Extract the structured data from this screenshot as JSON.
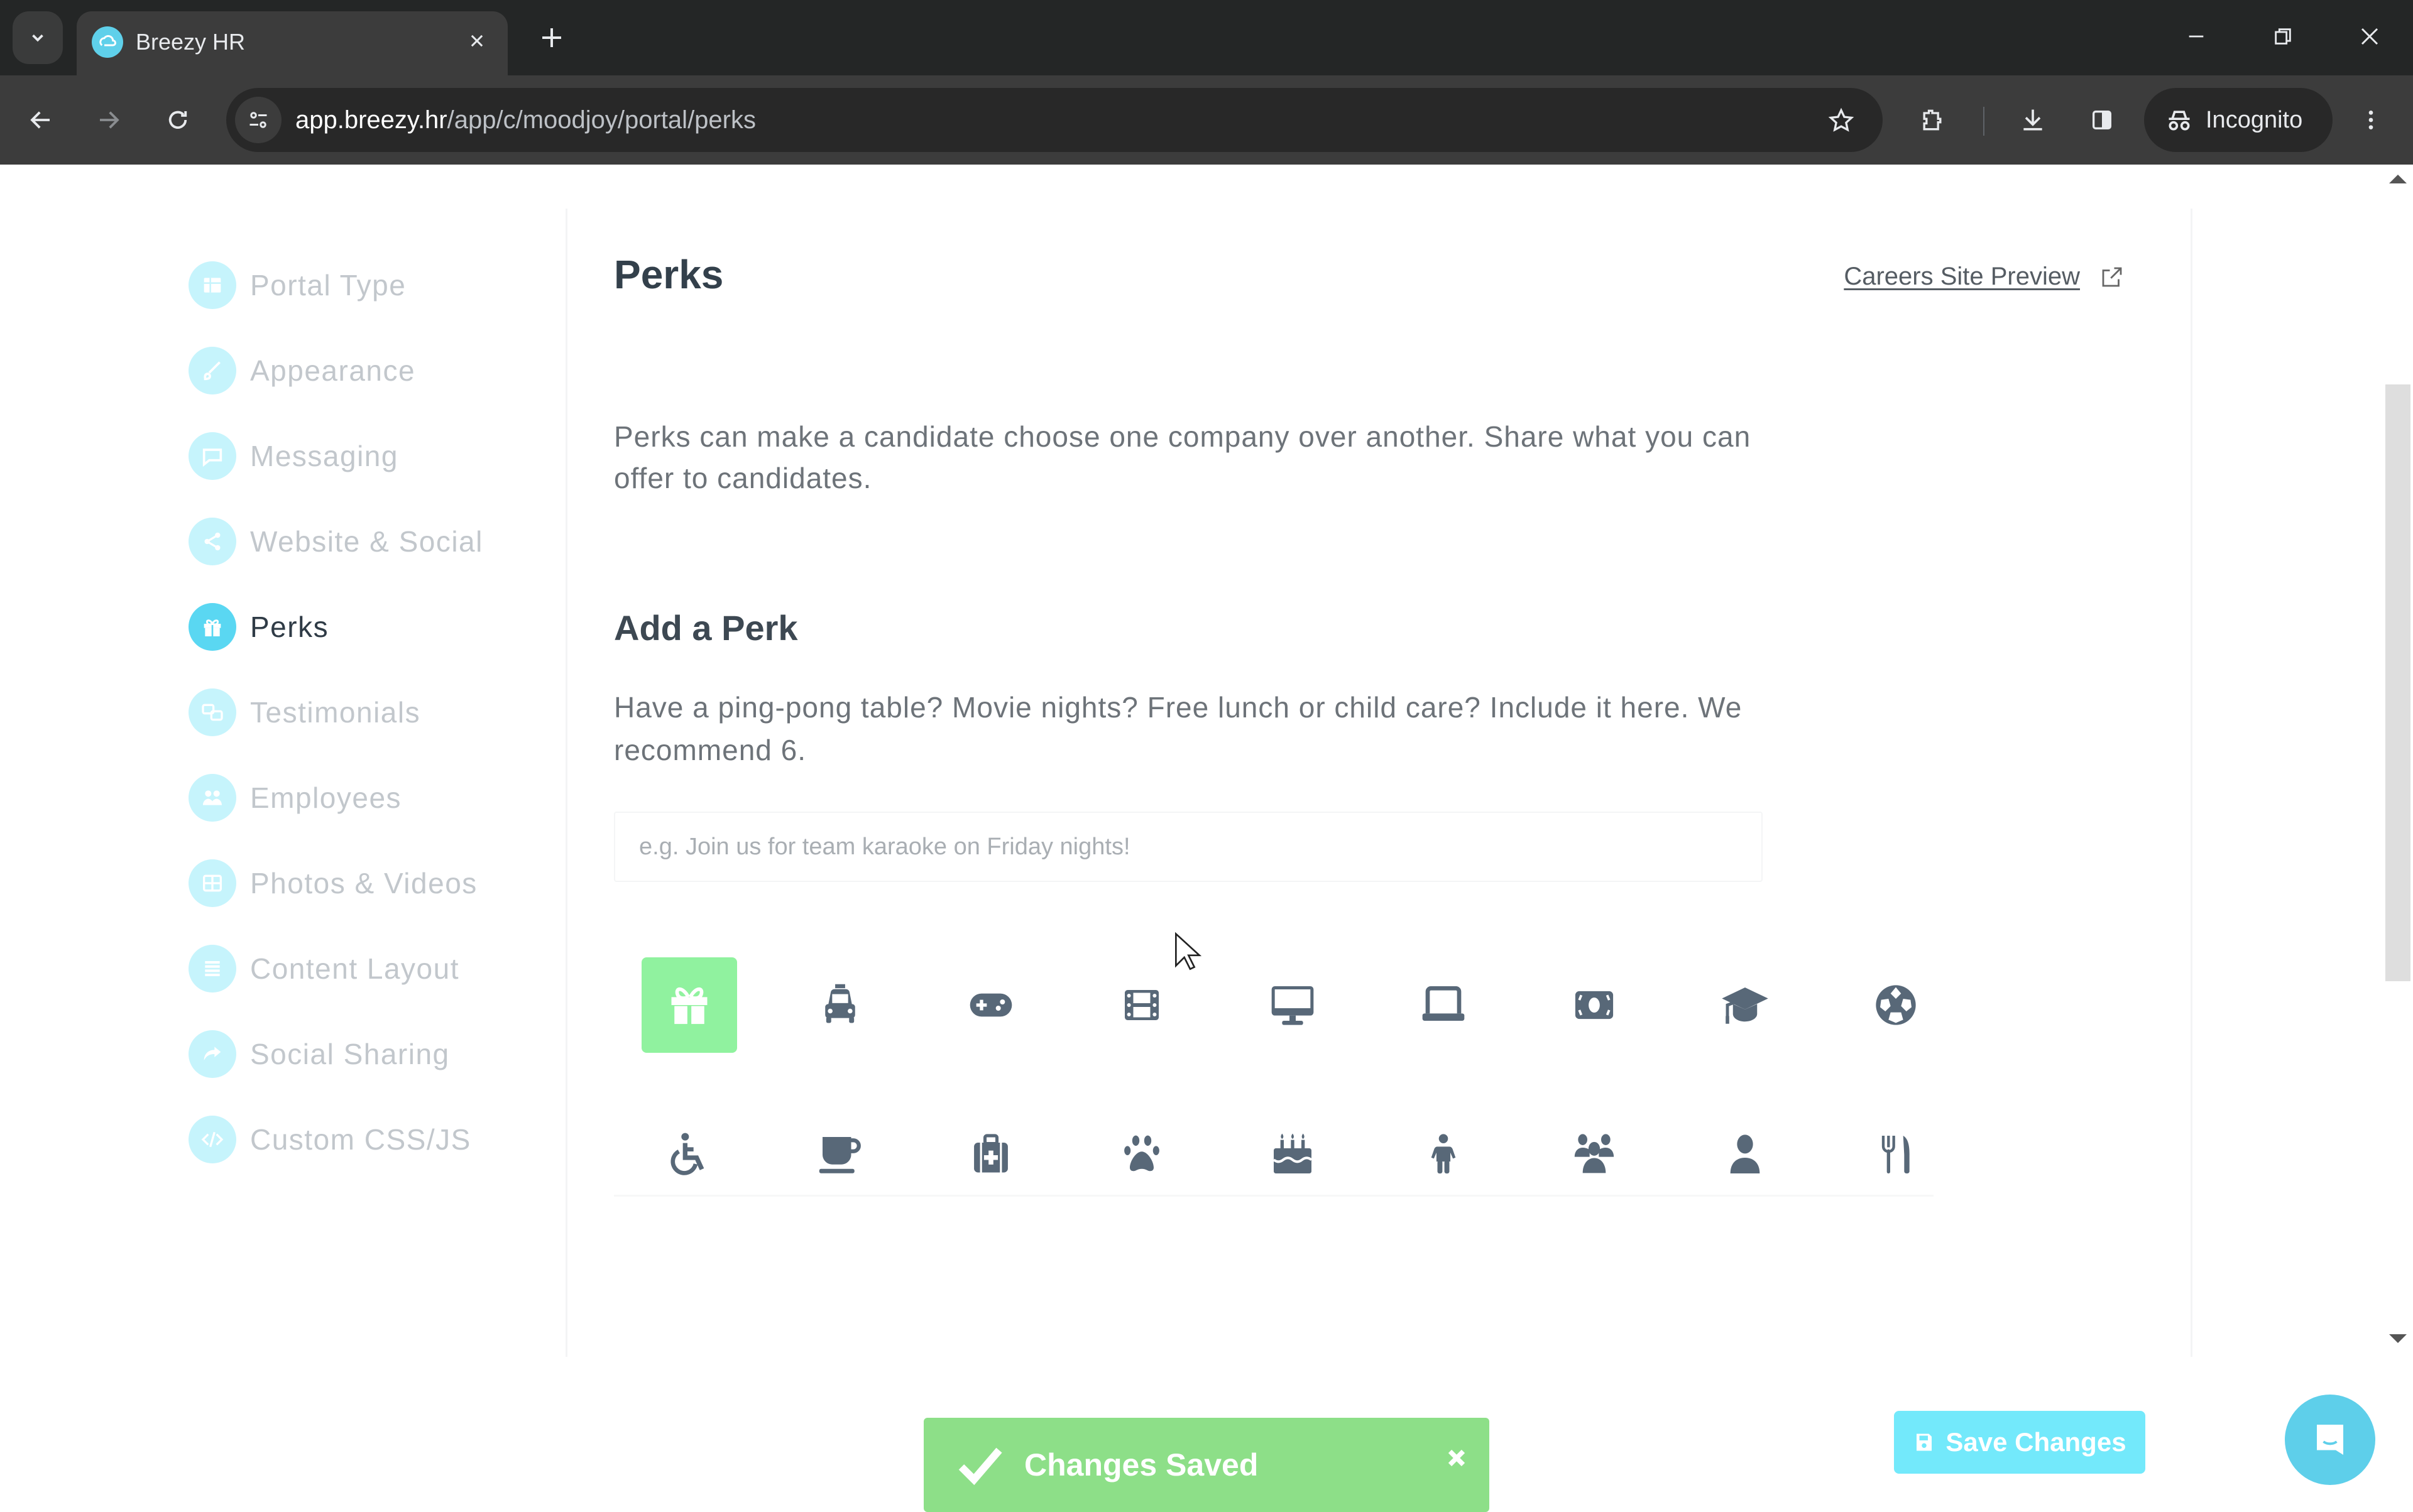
{
  "browser": {
    "tab_title": "Breezy HR",
    "url_host": "app.breezy.hr",
    "url_path": "/app/c/moodjoy/portal/perks",
    "incognito_label": "Incognito"
  },
  "sidebar": {
    "items": [
      {
        "label": "Portal Type",
        "icon": "portal-type-icon",
        "active": false
      },
      {
        "label": "Appearance",
        "icon": "paintbrush-icon",
        "active": false
      },
      {
        "label": "Messaging",
        "icon": "message-icon",
        "active": false
      },
      {
        "label": "Website & Social",
        "icon": "share-icon",
        "active": false
      },
      {
        "label": "Perks",
        "icon": "gift-icon",
        "active": true
      },
      {
        "label": "Testimonials",
        "icon": "testimonials-icon",
        "active": false
      },
      {
        "label": "Employees",
        "icon": "employees-icon",
        "active": false
      },
      {
        "label": "Photos & Videos",
        "icon": "photos-icon",
        "active": false
      },
      {
        "label": "Content Layout",
        "icon": "layout-icon",
        "active": false
      },
      {
        "label": "Social Sharing",
        "icon": "social-sharing-icon",
        "active": false
      },
      {
        "label": "Custom CSS/JS",
        "icon": "code-icon",
        "active": false
      }
    ]
  },
  "main": {
    "title": "Perks",
    "preview_link": "Careers Site Preview",
    "intro": "Perks can make a candidate choose one company over another. Share what you can offer to candidates.",
    "add_heading": "Add a Perk",
    "add_description": "Have a ping-pong table? Movie nights? Free lunch or child care? Include it here. We recommend 6.",
    "perk_input": {
      "value": "",
      "placeholder": "e.g. Join us for team karaoke on Friday nights!"
    },
    "perk_icons": [
      [
        "gift-icon",
        "taxi-icon",
        "gamepad-icon",
        "film-icon",
        "desktop-icon",
        "laptop-icon",
        "money-icon",
        "graduation-cap-icon",
        "soccer-ball-icon"
      ],
      [
        "wheelchair-icon",
        "coffee-icon",
        "medkit-icon",
        "paw-icon",
        "birthday-cake-icon",
        "child-icon",
        "users-icon",
        "user-icon",
        "utensils-icon"
      ]
    ],
    "selected_icon": "gift-icon",
    "save_button": "Save Changes"
  },
  "toast": {
    "message": "Changes Saved",
    "type": "success"
  },
  "colors": {
    "accent": "#5ad7f2",
    "selected_icon_bg": "#90f29f",
    "toast_bg": "#8ddf88",
    "save_button_bg": "#73e9fb",
    "icon_color": "#586878"
  }
}
